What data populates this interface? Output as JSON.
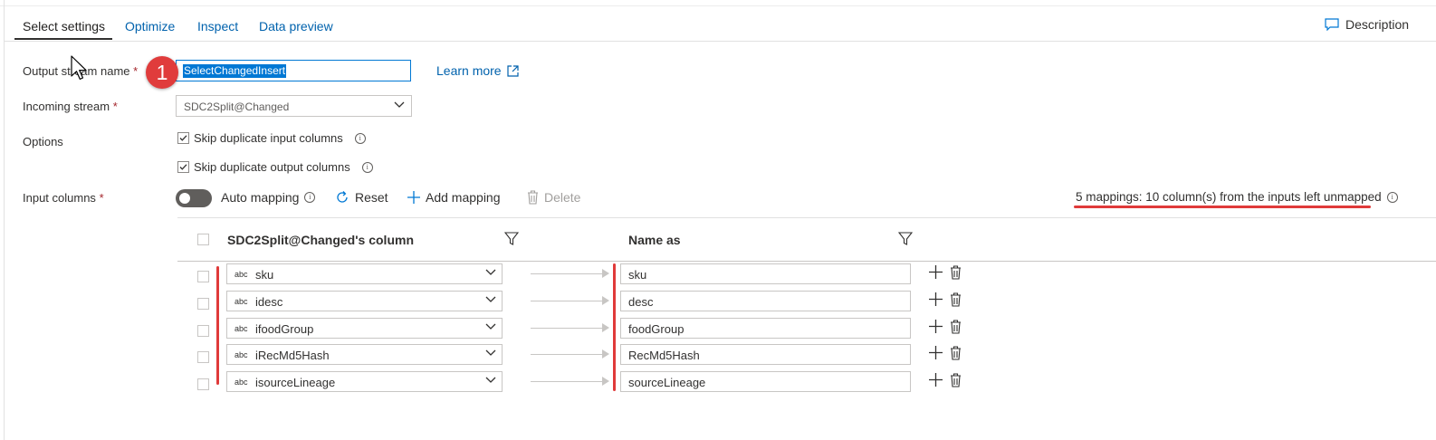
{
  "tabs": [
    {
      "label": "Select settings",
      "active": true
    },
    {
      "label": "Optimize",
      "active": false
    },
    {
      "label": "Inspect",
      "active": false
    },
    {
      "label": "Data preview",
      "active": false
    }
  ],
  "description_button": {
    "label": "Description",
    "icon": "comment-icon"
  },
  "form": {
    "output_stream": {
      "label": "Output stream name",
      "required_mark": "*",
      "value": "SelectChangedInsert",
      "learn_more": "Learn more"
    },
    "incoming_stream": {
      "label": "Incoming stream",
      "required_mark": "*",
      "value": "SDC2Split@Changed"
    },
    "options": {
      "label": "Options",
      "skip_input": {
        "label": "Skip duplicate input columns",
        "checked": true
      },
      "skip_output": {
        "label": "Skip duplicate output columns",
        "checked": true
      }
    },
    "input_columns": {
      "label": "Input columns",
      "required_mark": "*"
    }
  },
  "toolbar": {
    "auto_mapping": {
      "label": "Auto mapping",
      "on": false
    },
    "reset": "Reset",
    "add_mapping": "Add mapping",
    "delete": "Delete",
    "summary": "5 mappings: 10 column(s) from the inputs left unmapped"
  },
  "grid": {
    "source_header": "SDC2Split@Changed's column",
    "target_header": "Name as",
    "type_badge": "abc",
    "rows": [
      {
        "source": "sku",
        "target": "sku"
      },
      {
        "source": "idesc",
        "target": "desc"
      },
      {
        "source": "ifoodGroup",
        "target": "foodGroup"
      },
      {
        "source": "iRecMd5Hash",
        "target": "RecMd5Hash"
      },
      {
        "source": "isourceLineage",
        "target": "sourceLineage"
      }
    ]
  },
  "annotation": {
    "badge_number": "1",
    "highlight_color": "#e03a3a"
  }
}
